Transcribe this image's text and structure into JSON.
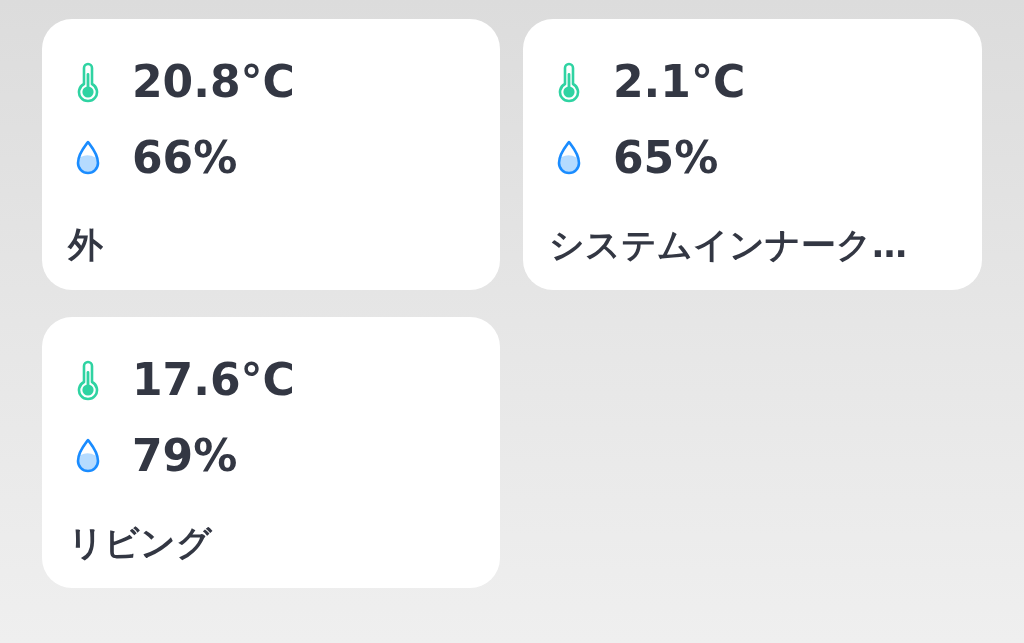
{
  "sensors": [
    {
      "temperature": "20.8°C",
      "humidity": "66%",
      "name": "外"
    },
    {
      "temperature": "2.1°C",
      "humidity": "65%",
      "name": "システムインナーク…"
    },
    {
      "temperature": "17.6°C",
      "humidity": "79%",
      "name": "リビング"
    }
  ]
}
